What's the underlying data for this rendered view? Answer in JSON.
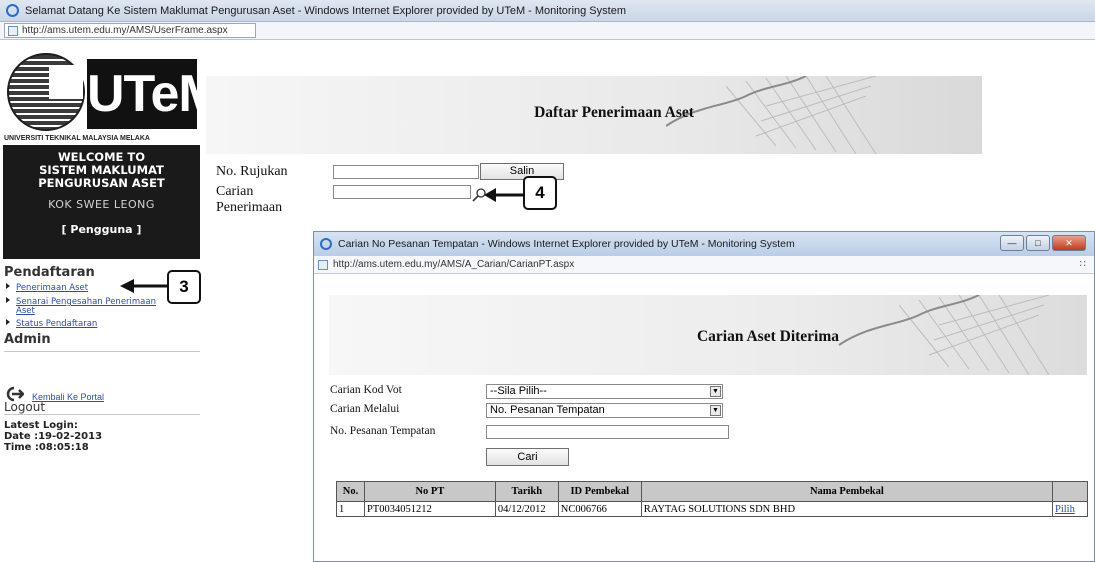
{
  "browser": {
    "title": "Selamat Datang Ke Sistem Maklumat Pengurusan Aset - Windows Internet Explorer provided by UTeM - Monitoring System",
    "url": "http://ams.utem.edu.my/AMS/UserFrame.aspx"
  },
  "sidebar": {
    "logo_text": "UTeM",
    "university_name": "UNIVERSITI TEKNIKAL MALAYSIA MELAKA",
    "welcome_line1": "WELCOME TO",
    "welcome_line2": "SISTEM MAKLUMAT",
    "welcome_line3": "PENGURUSAN ASET",
    "user_name": "KOK SWEE LEONG",
    "user_role": "[ Pengguna ]",
    "section_pendaftaran": "Pendaftaran",
    "items": [
      {
        "label": "Penerimaan Aset"
      },
      {
        "label": "Senarai Pengesahan Penerimaan"
      },
      {
        "label": "Aset"
      },
      {
        "label": "Status Pendaftaran"
      }
    ],
    "section_admin": "Admin",
    "portal_link": "Kembali Ke Portal",
    "logout": "Logout",
    "latest_login_label": "Latest Login:",
    "date_line": "Date :19-02-2013",
    "time_line": "Time :08:05:18"
  },
  "main": {
    "page_title": "Daftar Penerimaan Aset",
    "rujukan_label": "No. Rujukan",
    "salin_button": "Salin",
    "carian_label_1": "Carian",
    "carian_label_2": "Penerimaan",
    "rujukan_value": "",
    "carian_value": ""
  },
  "callouts": {
    "sidebar_step": "3",
    "search_step": "4"
  },
  "popup": {
    "title": "Carian No Pesanan Tempatan - Windows Internet Explorer provided by UTeM - Monitoring System",
    "url": "http://ams.utem.edu.my/AMS/A_Carian/CarianPT.aspx",
    "page_title": "Carian Aset Diterima",
    "kod_vot_label": "Carian Kod Vot",
    "kod_vot_value": "--Sila Pilih--",
    "melalui_label": "Carian Melalui",
    "melalui_value": "No. Pesanan Tempatan",
    "pt_label": "No. Pesanan Tempatan",
    "pt_value": "",
    "cari_button": "Cari",
    "table": {
      "headers": [
        "No.",
        "No PT",
        "Tarikh",
        "ID Pembekal",
        "Nama Pembekal",
        ""
      ],
      "rows": [
        [
          "1",
          "PT0034051212",
          "04/12/2012",
          "NC006766",
          "RAYTAG SOLUTIONS SDN BHD",
          "Pilih"
        ]
      ]
    }
  }
}
